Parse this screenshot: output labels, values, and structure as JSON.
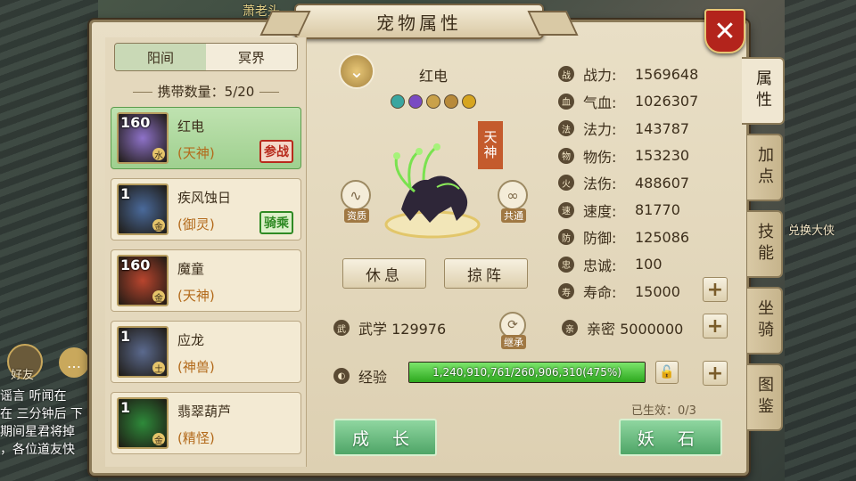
{
  "background": {
    "npc_name": "萧老头",
    "sign_text": "兑换大侠",
    "friend_label": "好友",
    "chat_lines": [
      "谣言 听闻在",
      "在 三分钟后 下",
      "期间星君将掉",
      "，各位道友快"
    ]
  },
  "window": {
    "title": "宠物属性",
    "close_label": "✕"
  },
  "realm_tabs": [
    {
      "label": "阳间",
      "active": true
    },
    {
      "label": "冥界",
      "active": false
    }
  ],
  "carry_count": "携带数量：5/20",
  "pets": [
    {
      "level": "160",
      "element": "水",
      "name": "红电",
      "type": "(天神)",
      "stamp": "参战",
      "stamp_color": "red",
      "selected": true,
      "portrait_color": "#8e72c9"
    },
    {
      "level": "1",
      "element": "金",
      "name": "疾风蚀日",
      "type": "(御灵)",
      "stamp": "骑乘",
      "stamp_color": "green",
      "selected": false,
      "portrait_color": "#4a6a9b"
    },
    {
      "level": "160",
      "element": "金",
      "name": "魔童",
      "type": "(天神)",
      "stamp": "",
      "stamp_color": "",
      "selected": false,
      "portrait_color": "#b8452e"
    },
    {
      "level": "1",
      "element": "土",
      "name": "应龙",
      "type": "(神兽)",
      "stamp": "",
      "stamp_color": "",
      "selected": false,
      "portrait_color": "#5b6a8e"
    },
    {
      "level": "1",
      "element": "金",
      "name": "翡翠葫芦",
      "type": "(精怪)",
      "stamp": "",
      "stamp_color": "",
      "selected": false,
      "portrait_color": "#2e8a3a"
    }
  ],
  "detail": {
    "name": "红电",
    "rank": "天神",
    "skill_icons": [
      "水",
      "灵",
      "风",
      "羽",
      "神"
    ],
    "aptitude_label": "资质",
    "share_label": "共通",
    "rest_button": "休息",
    "lineup_button": "掠阵",
    "martial_label": "武学 129976",
    "inherit_label": "继承",
    "intimacy_label": "亲密 5000000",
    "exp_label": "经验",
    "exp_text": "1,240,910,761/260,906,310(475%)",
    "exp_progress": 1.0,
    "effect_text": "已生效：0/3",
    "grow_button": "成 长",
    "demon_stone_button": "妖 石"
  },
  "stats": [
    {
      "icon": "战",
      "label": "战力:",
      "value": "1569648"
    },
    {
      "icon": "血",
      "label": "气血:",
      "value": "1026307"
    },
    {
      "icon": "法",
      "label": "法力:",
      "value": "143787"
    },
    {
      "icon": "物",
      "label": "物伤:",
      "value": "153230"
    },
    {
      "icon": "火",
      "label": "法伤:",
      "value": "488607"
    },
    {
      "icon": "速",
      "label": "速度:",
      "value": "81770"
    },
    {
      "icon": "防",
      "label": "防御:",
      "value": "125086"
    },
    {
      "icon": "忠",
      "label": "忠诚:",
      "value": "100"
    },
    {
      "icon": "寿",
      "label": "寿命:",
      "value": "15000"
    }
  ],
  "side_tabs": [
    {
      "label": "属性",
      "active": true
    },
    {
      "label": "加点",
      "active": false
    },
    {
      "label": "技能",
      "active": false
    },
    {
      "label": "坐骑",
      "active": false
    },
    {
      "label": "图鉴",
      "active": false
    }
  ],
  "colors": {
    "accent_green": "#4fa567",
    "stamp_red": "#b82a1c",
    "close_red": "#b3241c"
  }
}
